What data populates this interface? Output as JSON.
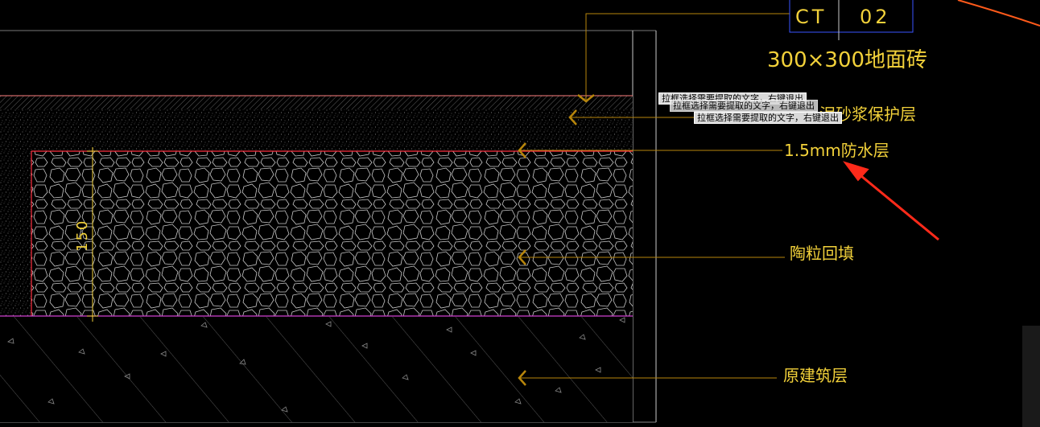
{
  "tag": {
    "left": "CT",
    "right": "02"
  },
  "labels": {
    "tile": "300×300地面砖",
    "mortar_suffix": "泥砂浆保护层",
    "waterproof": "1.5mm防水层",
    "ceramsite": "陶粒回填",
    "original": "原建筑层"
  },
  "dimension": {
    "value": "150"
  },
  "tooltips": [
    "拉框选择需要提取的文字，右键退出",
    "拉框选择需要提取的文字，右键退出",
    "拉框选择需要提取的文字，右键退出"
  ],
  "colors": {
    "background": "#000000",
    "text": "#f2d13a",
    "leader": "#b8860b",
    "outline": "#c8c8c8",
    "hatch": "#8a8a8a",
    "waterproof_line": "#ff3040",
    "magenta_line": "#d040d0",
    "tag_box": "#3a55ff",
    "arrow": "#ff2a1a"
  }
}
